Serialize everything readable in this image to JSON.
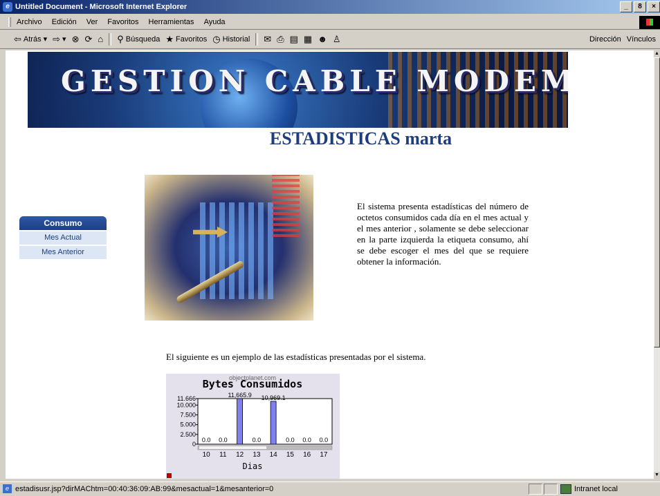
{
  "window": {
    "title": "Untitled Document - Microsoft Internet Explorer",
    "buttons": [
      "_",
      "8",
      "×"
    ]
  },
  "menu": [
    "Archivo",
    "Edición",
    "Ver",
    "Favoritos",
    "Herramientas",
    "Ayuda"
  ],
  "toolbar": {
    "back": "Atrás",
    "search": "Búsqueda",
    "favorites": "Favoritos",
    "history": "Historial",
    "address": "Dirección",
    "links": "Vínculos"
  },
  "page": {
    "banner": "GESTION CABLE MODEMS",
    "title": "ESTADISTICAS marta",
    "sidebar": {
      "header": "Consumo",
      "links": [
        "Mes Actual",
        "Mes Anterior"
      ]
    },
    "description": "El sistema presenta estadísticas del número de octetos consumidos cada día en el mes actual y el mes anterior , solamente se debe seleccionar en la parte izquierda la etiqueta consumo, ahí se debe escoger el mes del que se requiere obtener la información.",
    "example_text": "El siguiente es un ejemplo de las estadísticas presentadas por el sistema."
  },
  "chart_data": {
    "type": "bar",
    "watermark": "objectplanet.com",
    "title": "Bytes Consumidos",
    "xlabel": "Dias",
    "ylabel": "",
    "categories": [
      "10",
      "11",
      "12",
      "13",
      "14",
      "15",
      "16",
      "17"
    ],
    "values": [
      0,
      0,
      11665.9,
      0,
      10969.1,
      0,
      0,
      0
    ],
    "value_labels": [
      "0.0",
      "0.0",
      "11,665.9",
      "0.0",
      "10,969.1",
      "0.0",
      "0.0",
      "0.0"
    ],
    "yticks": [
      "0",
      "2.500",
      "5.000",
      "7.500",
      "10.000",
      "11.666"
    ],
    "ytick_values": [
      0,
      2500,
      5000,
      7500,
      10000,
      11666
    ],
    "ylim": [
      0,
      11666
    ],
    "bar_color": "#8080f0"
  },
  "status": {
    "text": "estadisusr.jsp?dirMAChtm=00:40:36:09:AB:99&mesactual=1&mesanterior=0",
    "zone": "Intranet local"
  }
}
